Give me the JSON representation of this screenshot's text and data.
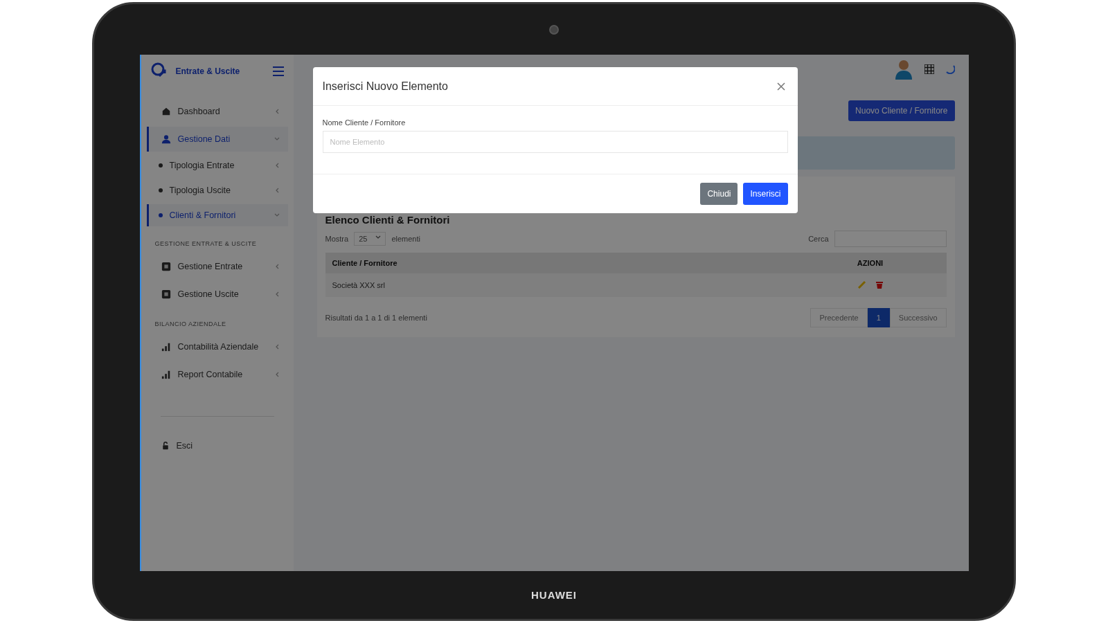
{
  "device": {
    "brand": "HUAWEI"
  },
  "sidebar": {
    "brand": "Entrate & Uscite",
    "sections": [
      {
        "items": [
          {
            "label": "Dashboard",
            "selected": false,
            "expanded": false
          },
          {
            "label": "Gestione Dati",
            "selected": true,
            "expanded": true,
            "children": [
              {
                "label": "Tipologia Entrate",
                "selected": false,
                "expanded": false
              },
              {
                "label": "Tipologia Uscite",
                "selected": false,
                "expanded": false
              },
              {
                "label": "Clienti & Fornitori",
                "selected": true,
                "expanded": true
              }
            ]
          }
        ]
      },
      {
        "header": "GESTIONE ENTRATE & USCITE",
        "items": [
          {
            "label": "Gestione Entrate",
            "selected": false,
            "expanded": false
          },
          {
            "label": "Gestione Uscite",
            "selected": false,
            "expanded": false
          }
        ]
      },
      {
        "header": "BILANCIO AZIENDALE",
        "items": [
          {
            "label": "Contabilità Aziendale",
            "selected": false,
            "expanded": false
          },
          {
            "label": "Report Contabile",
            "selected": false,
            "expanded": false
          }
        ]
      }
    ],
    "logout": "Esci"
  },
  "page": {
    "new_button": "Nuovo Cliente / Fornitore",
    "card": {
      "title": "Elenco Clienti & Fornitori",
      "length": {
        "prefix": "Mostra",
        "value": "25",
        "suffix": "elementi"
      },
      "search": {
        "label": "Cerca"
      },
      "table": {
        "columns": [
          "Cliente / Fornitore",
          "AZIONI"
        ],
        "rows": [
          {
            "name": "Società XXX srl"
          }
        ]
      },
      "info": "Risultati da 1 a 1 di 1 elementi",
      "pagination": [
        {
          "label": "Precedente",
          "selected": false
        },
        {
          "label": "1",
          "selected": true
        },
        {
          "label": "Successivo",
          "selected": false
        }
      ]
    }
  },
  "modal": {
    "title": "Inserisci Nuovo Elemento",
    "field": {
      "label": "Nome Cliente / Fornitore",
      "placeholder": "Nome Elemento"
    },
    "buttons": [
      {
        "label": "Chiudi",
        "kind": "secondary"
      },
      {
        "label": "Inserisci",
        "kind": "primary"
      }
    ]
  }
}
